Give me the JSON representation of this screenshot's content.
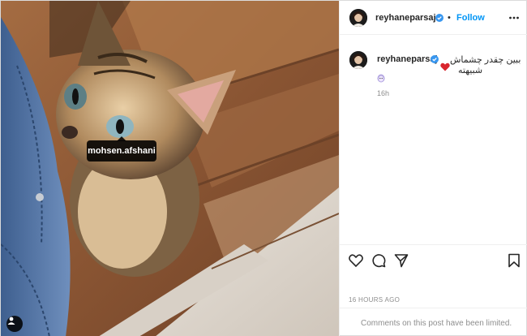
{
  "header": {
    "username": "reyhaneparsaj",
    "separator": "•",
    "follow_label": "Follow",
    "more_icon": "more-horizontal-icon",
    "verified_icon": "verified-badge-icon"
  },
  "media": {
    "tag_label": "mohsen.afshani",
    "user_tag_icon": "user-tag-icon"
  },
  "caption": {
    "username": "reyhaneparsaj",
    "line1": "ببین چقدر چشماش",
    "line2": "شبیهته",
    "heart_emoji": "heart-emoji",
    "face_emoji": "face-emoji",
    "time": "16h"
  },
  "actions": {
    "like_icon": "heart-icon",
    "comment_icon": "comment-icon",
    "share_icon": "share-icon",
    "save_icon": "bookmark-icon"
  },
  "posted_time": "16 HOURS AGO",
  "comments_notice": "Comments on this post have been limited.",
  "colors": {
    "accent": "#0095f6",
    "text": "#262626",
    "secondary": "#8e8e8e",
    "heart": "#d9262e"
  }
}
